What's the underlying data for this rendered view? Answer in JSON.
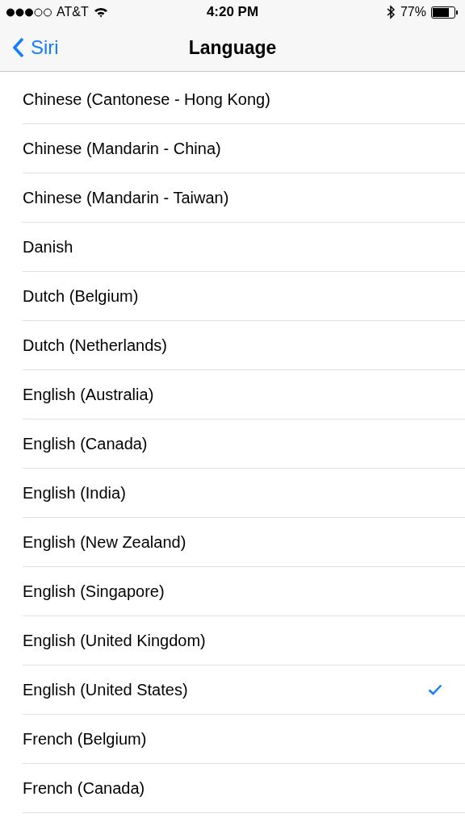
{
  "status_bar": {
    "carrier": "AT&T",
    "time": "4:20 PM",
    "battery": "77%"
  },
  "nav": {
    "back": "Siri",
    "title": "Language"
  },
  "languages": [
    {
      "label": "Chinese (Cantonese - Hong Kong)",
      "selected": false
    },
    {
      "label": "Chinese (Mandarin - China)",
      "selected": false
    },
    {
      "label": "Chinese (Mandarin - Taiwan)",
      "selected": false
    },
    {
      "label": "Danish",
      "selected": false
    },
    {
      "label": "Dutch (Belgium)",
      "selected": false
    },
    {
      "label": "Dutch (Netherlands)",
      "selected": false
    },
    {
      "label": "English (Australia)",
      "selected": false
    },
    {
      "label": "English (Canada)",
      "selected": false
    },
    {
      "label": "English (India)",
      "selected": false
    },
    {
      "label": "English (New Zealand)",
      "selected": false
    },
    {
      "label": "English (Singapore)",
      "selected": false
    },
    {
      "label": "English (United Kingdom)",
      "selected": false
    },
    {
      "label": "English (United States)",
      "selected": true
    },
    {
      "label": "French (Belgium)",
      "selected": false
    },
    {
      "label": "French (Canada)",
      "selected": false
    }
  ]
}
